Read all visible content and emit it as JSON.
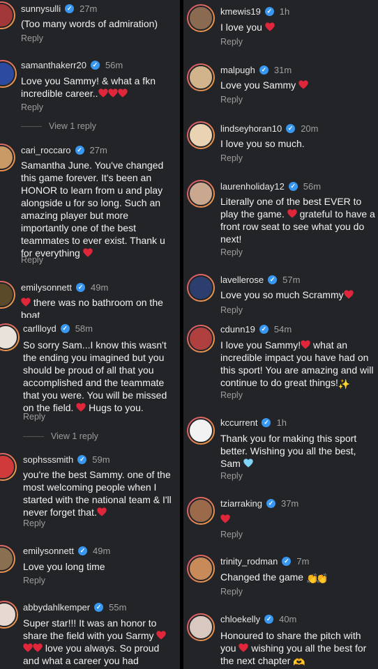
{
  "colors": {
    "heart": "#e0263a",
    "verified": "#3897f0",
    "background": "#232427"
  },
  "icons": {
    "verified": "verified-badge-icon",
    "heart": "red-heart-icon",
    "clap": "clapping-hands-icon",
    "sparkles": "sparkles-icon",
    "blue_heart": "blue-heart-icon",
    "hands": "heart-hands-icon"
  },
  "left": [
    {
      "username": "sunnysulli",
      "time": "27m",
      "text": "(Too many words of admiration)",
      "reply": "Reply"
    },
    {
      "username": "samanthakerr20",
      "time": "56m",
      "text": "Love you Sammy! & what a fkn incredible career..",
      "reply": "Reply",
      "view_replies": "View 1 reply"
    },
    {
      "username": "cari_roccaro",
      "time": "27m",
      "text": "Samantha June. You've changed this game forever. It's been an HONOR to learn from u and play alongside u for so long. Such an amazing player but more importantly one of the best teammates to ever exist. Thank u for everything",
      "reply": "Reply"
    },
    {
      "username": "emilysonnett",
      "time": "49m",
      "text": "there was no bathroom on the boat"
    },
    {
      "username": "carllloyd",
      "time": "58m",
      "text": "So sorry Sam...I know this wasn't the ending you imagined but you should be proud of all that you accomplished and the teammate that you were. You will be missed on the field.",
      "text_tail": "Hugs to you.",
      "reply": "Reply",
      "view_replies": "View 1 reply"
    },
    {
      "username": "sophsssmith",
      "time": "59m",
      "text": "you're the best Sammy. one of the most welcoming people when I started with the national team & I'll never forget that.",
      "reply": "Reply"
    },
    {
      "username": "emilysonnett",
      "time": "49m",
      "text": "Love you long time",
      "reply": "Reply"
    },
    {
      "username": "abbydahlkemper",
      "time": "55m",
      "text_a": "Super star!!! It was an honor to share the field with you Sarmy",
      "text_b": "love you always. So proud and what a career you had"
    }
  ],
  "right": [
    {
      "username": "kmewis19",
      "time": "1h",
      "text": "I love you",
      "reply": "Reply"
    },
    {
      "username": "malpugh",
      "time": "31m",
      "text": "Love you Sammy",
      "reply": "Reply"
    },
    {
      "username": "lindseyhoran10",
      "time": "20m",
      "text": "I love you so much.",
      "reply": "Reply"
    },
    {
      "username": "laurenholiday12",
      "time": "56m",
      "text_a": "Literally one of the best EVER to play the game.",
      "text_b": "grateful to have a front row seat to see what you do next!",
      "reply": "Reply"
    },
    {
      "username": "lavellerose",
      "time": "57m",
      "text": "Love you so much Scrammy",
      "reply": "Reply"
    },
    {
      "username": "cdunn19",
      "time": "54m",
      "text_a": "I love you Sammy!",
      "text_b": "what an incredible impact you have had on this sport! You are amazing and will continue to do great things!",
      "reply": "Reply"
    },
    {
      "username": "kccurrent",
      "time": "1h",
      "text": "Thank you for making this sport better. Wishing you all the best, Sam",
      "reply": "Reply"
    },
    {
      "username": "tziarraking",
      "time": "37m",
      "text": "",
      "reply": "Reply"
    },
    {
      "username": "trinity_rodman",
      "time": "7m",
      "text": "Changed the game",
      "reply": "Reply"
    },
    {
      "username": "chloekelly",
      "time": "40m",
      "text_a": "Honoured to share the pitch with you",
      "text_b": "wishing you all the best for the next chapter"
    }
  ]
}
